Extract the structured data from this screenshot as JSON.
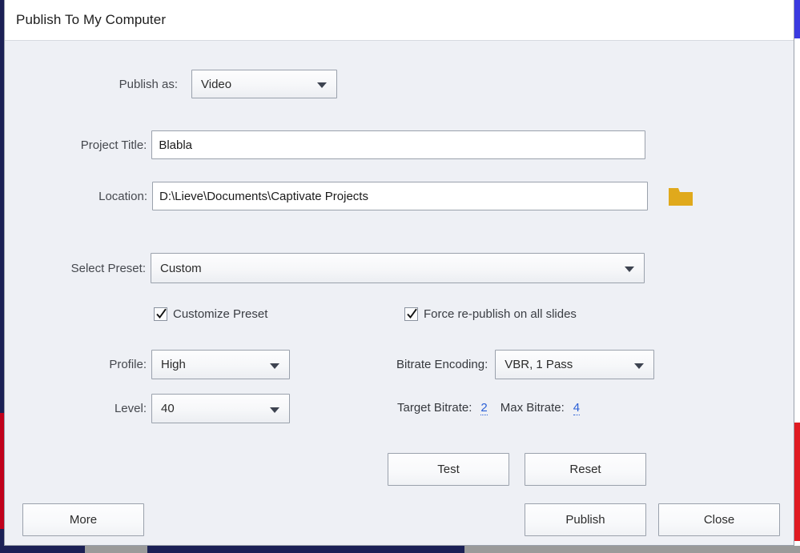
{
  "dialog": {
    "title": "Publish To My Computer"
  },
  "form": {
    "publish_as": {
      "label": "Publish as:",
      "value": "Video"
    },
    "project_title": {
      "label": "Project Title:",
      "value": "Blabla",
      "placeholder": ""
    },
    "location": {
      "label": "Location:",
      "value": "D:\\Lieve\\Documents\\Captivate Projects",
      "placeholder": "",
      "browse_icon": "folder-icon"
    },
    "select_preset": {
      "label": "Select Preset:",
      "value": "Custom"
    },
    "customize_preset": {
      "label": "Customize Preset",
      "checked": "true"
    },
    "force_republish": {
      "label": "Force re-publish on all slides",
      "checked": "true"
    },
    "profile": {
      "label": "Profile:",
      "value": "High"
    },
    "level": {
      "label": "Level:",
      "value": "40"
    },
    "bitrate_encoding": {
      "label": "Bitrate Encoding:",
      "value": "VBR, 1 Pass"
    },
    "target_bitrate": {
      "label": "Target Bitrate:",
      "value": "2"
    },
    "max_bitrate": {
      "label": "Max Bitrate:",
      "value": "4"
    }
  },
  "buttons": {
    "test": "Test",
    "reset": "Reset",
    "more": "More",
    "publish": "Publish",
    "close": "Close"
  },
  "colors": {
    "dialog_background": "#eef0f5",
    "titlebar_background": "#ffffff",
    "link_blue": "#2a5fd6",
    "folder_gold": "#e0a91c",
    "border_grey": "#9aa1ac",
    "backdrop_navy": "#1b2055",
    "backdrop_red": "#c0001b"
  }
}
